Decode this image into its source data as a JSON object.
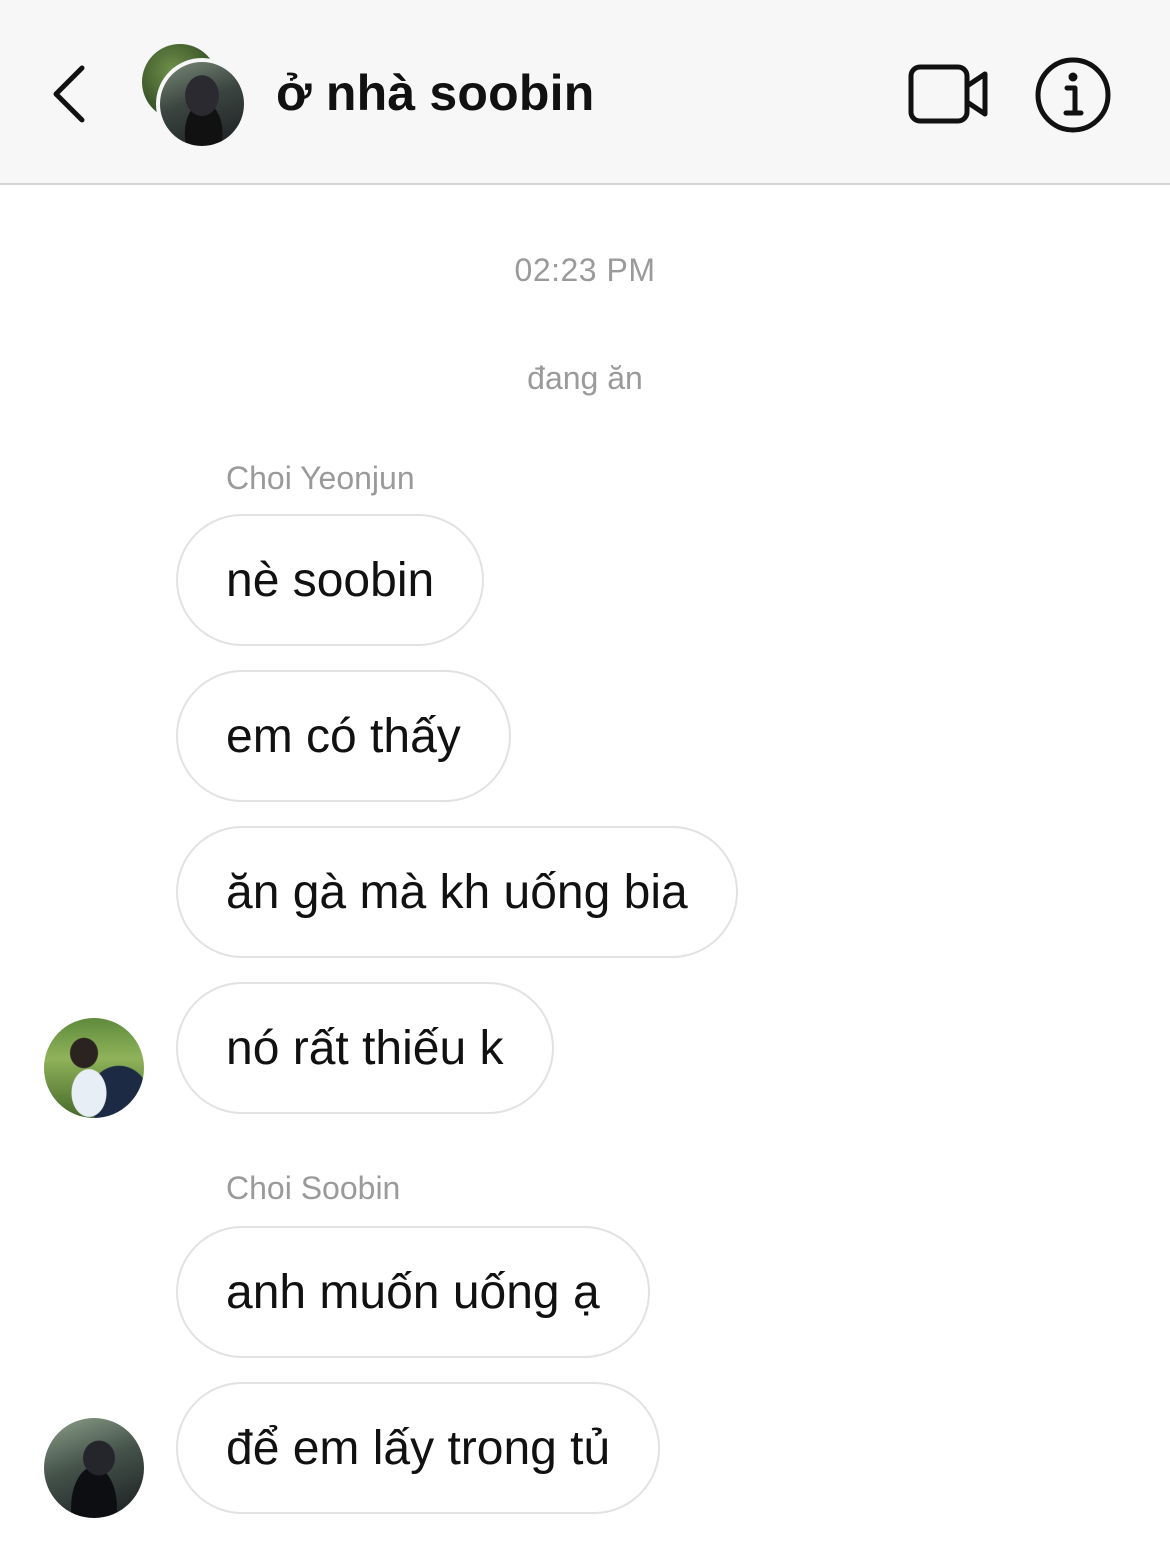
{
  "header": {
    "back_icon": "chevron-left-icon",
    "title": "ở nhà soobin",
    "video_icon": "video-camera-icon",
    "info_icon": "info-icon"
  },
  "thread": {
    "timestamp": "02:23 PM",
    "system_message": "đang ăn",
    "groups": [
      {
        "sender": "Choi Yeonjun",
        "messages": [
          "nè soobin",
          "em có thấy",
          "ăn gà mà kh uống bia",
          "nó rất thiếu k"
        ]
      },
      {
        "sender": "Choi Soobin",
        "messages": [
          "anh muốn uống ạ",
          "để em lấy trong tủ"
        ]
      }
    ]
  },
  "colors": {
    "header_bg": "#f7f7f7",
    "meta_text": "#9a9a9a",
    "bubble_border": "#e2e2e2"
  }
}
